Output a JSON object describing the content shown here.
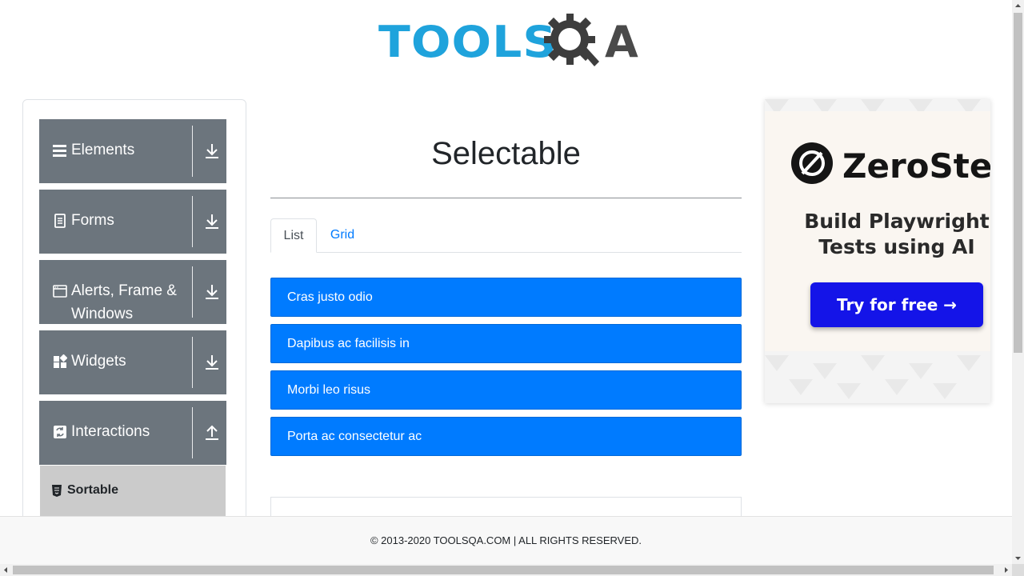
{
  "header": {
    "logo_part1": "TOOLS",
    "logo_part2": "A"
  },
  "sidebar": {
    "groups": [
      {
        "label": "Elements",
        "icon": "hamburger-icon",
        "arrow": "download-icon"
      },
      {
        "label": "Forms",
        "icon": "document-icon",
        "arrow": "download-icon"
      },
      {
        "label": "Alerts, Frame & Windows",
        "icon": "window-icon",
        "arrow": "download-icon"
      },
      {
        "label": "Widgets",
        "icon": "widgets-icon",
        "arrow": "download-icon"
      },
      {
        "label": "Interactions",
        "icon": "interactions-icon",
        "arrow": "upload-icon"
      }
    ],
    "sub_items": [
      {
        "label": "Sortable",
        "icon": "html5-icon"
      }
    ]
  },
  "main": {
    "title": "Selectable",
    "tabs": [
      {
        "label": "List",
        "active": true
      },
      {
        "label": "Grid",
        "active": false
      }
    ],
    "list_items": [
      "Cras justo odio",
      "Dapibus ac facilisis in",
      "Morbi leo risus",
      "Porta ac consectetur ac"
    ]
  },
  "ad": {
    "brand": "ZeroStep",
    "headline": "Build Playwright Tests using AI",
    "cta": "Try for free →"
  },
  "footer": {
    "text": "© 2013-2020 TOOLSQA.COM | ALL RIGHTS RESERVED."
  },
  "colors": {
    "primary": "#007bff",
    "sidebar_group": "#6c757d",
    "sub_item_active": "#cbcbcb",
    "logo_blue": "#1fa3dc",
    "ad_cta": "#1414e8"
  }
}
